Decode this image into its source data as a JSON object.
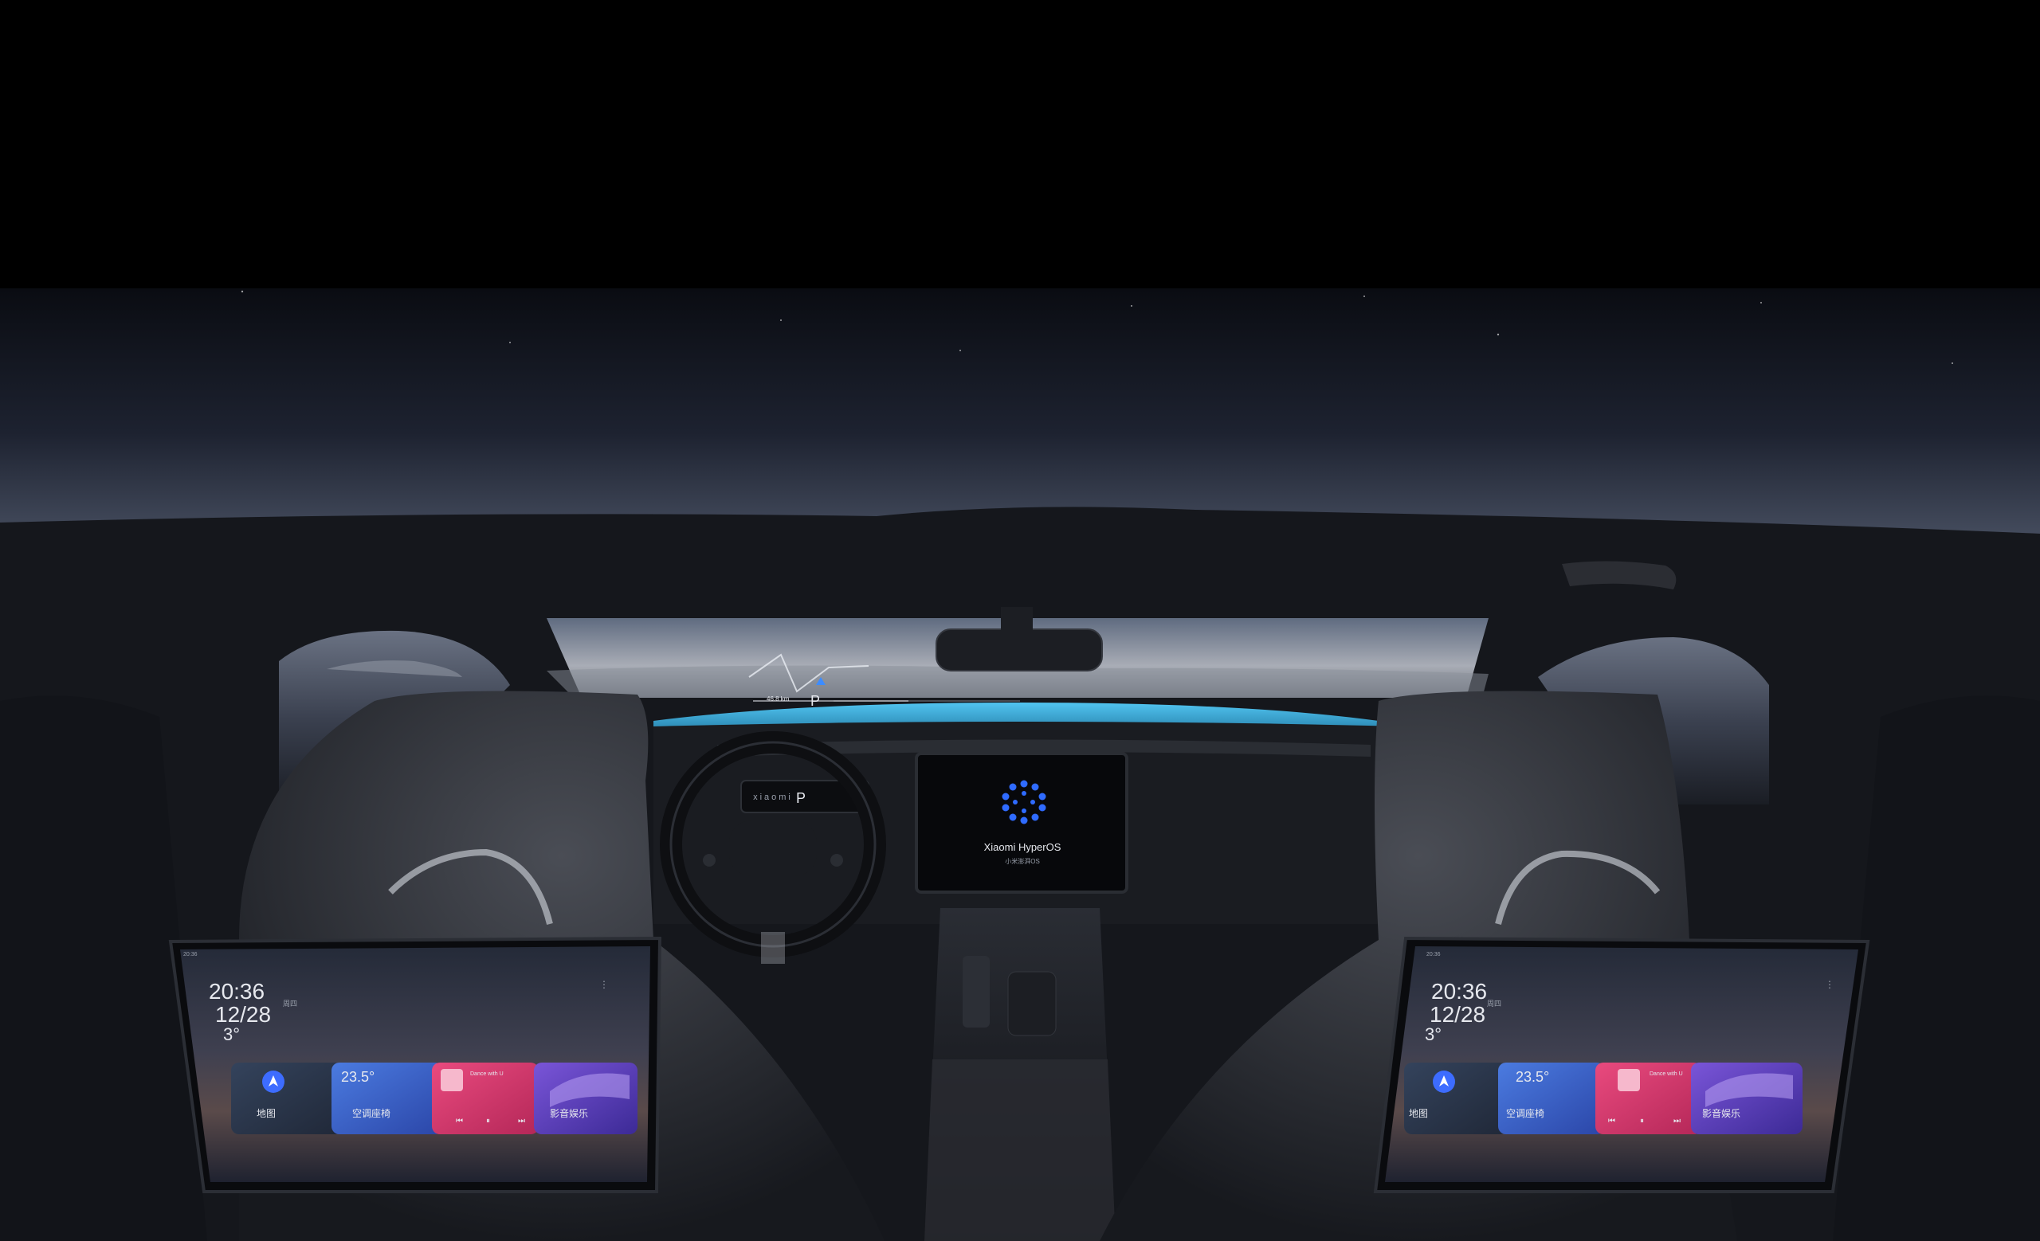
{
  "center_display": {
    "brand": "Xiaomi HyperOS",
    "subtitle": "小米澎湃OS"
  },
  "steering_wheel": {
    "logo": "xiaomi"
  },
  "instrument_cluster": {
    "gear": "P"
  },
  "hud": {
    "gear": "P",
    "distance": "46.8 km"
  },
  "rear_tablet_left": {
    "status_time": "20:36",
    "clock": "20:36",
    "date": "12/28",
    "weekday": "周四",
    "temperature": "3°",
    "cards": [
      {
        "title": "地图",
        "subtitle": "",
        "icon": "navigation-arrow-icon",
        "color": "#2c3b52"
      },
      {
        "title": "空调座椅",
        "value": "23.5°",
        "subtitle": "",
        "color": "#3a63c8"
      },
      {
        "title": "Dance with U",
        "subtitle": "",
        "icon": "album-cover-icon",
        "color": "#d8386c"
      },
      {
        "title": "影音娱乐",
        "subtitle": "",
        "icon": "media-wave-icon",
        "color": "#5a3fb6"
      }
    ]
  },
  "rear_tablet_right": {
    "status_time": "20:36",
    "clock": "20:36",
    "date": "12/28",
    "weekday": "周四",
    "temperature": "3°",
    "cards": [
      {
        "title": "地图",
        "subtitle": "",
        "icon": "navigation-arrow-icon",
        "color": "#2c3b52"
      },
      {
        "title": "空调座椅",
        "value": "23.5°",
        "subtitle": "",
        "color": "#3a63c8"
      },
      {
        "title": "Dance with U",
        "subtitle": "",
        "icon": "album-cover-icon",
        "color": "#d8386c"
      },
      {
        "title": "影音娱乐",
        "subtitle": "",
        "icon": "media-wave-icon",
        "color": "#5a3fb6"
      }
    ]
  },
  "colors": {
    "sky_top": "#0b0d14",
    "sky_horizon": "#4b5365",
    "hood_accent": "#3fb6e6",
    "hyperos_blue": "#2f6bff",
    "interior_dark": "#121419"
  }
}
